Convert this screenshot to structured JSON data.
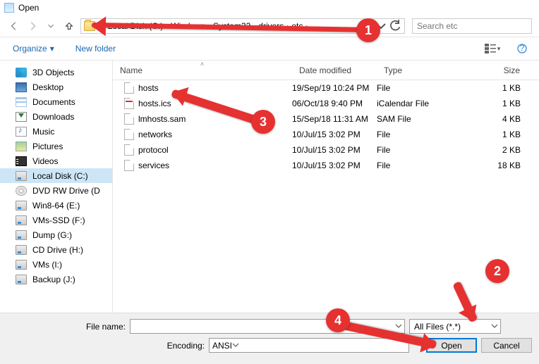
{
  "window": {
    "title": "Open"
  },
  "nav": {
    "breadcrumb": [
      "Local Disk (C:)",
      "Windows",
      "System32",
      "drivers",
      "etc"
    ],
    "search_placeholder": "Search etc"
  },
  "toolbar": {
    "organize": "Organize",
    "new_folder": "New folder"
  },
  "sidebar": {
    "items": [
      {
        "icon": "ic-3d",
        "label": "3D Objects"
      },
      {
        "icon": "ic-desktop",
        "label": "Desktop"
      },
      {
        "icon": "ic-doc",
        "label": "Documents"
      },
      {
        "icon": "ic-dl",
        "label": "Downloads"
      },
      {
        "icon": "ic-music",
        "label": "Music"
      },
      {
        "icon": "ic-pic",
        "label": "Pictures"
      },
      {
        "icon": "ic-vid",
        "label": "Videos"
      },
      {
        "icon": "ic-disk",
        "label": "Local Disk (C:)",
        "selected": true
      },
      {
        "icon": "ic-dvd",
        "label": "DVD RW Drive (D"
      },
      {
        "icon": "ic-disk",
        "label": "Win8-64 (E:)"
      },
      {
        "icon": "ic-disk",
        "label": "VMs-SSD (F:)"
      },
      {
        "icon": "ic-disk",
        "label": "Dump (G:)"
      },
      {
        "icon": "ic-disk",
        "label": "CD Drive (H:)"
      },
      {
        "icon": "ic-disk",
        "label": "VMs (I:)"
      },
      {
        "icon": "ic-disk",
        "label": "Backup (J:)"
      }
    ]
  },
  "columns": {
    "name": "Name",
    "date": "Date modified",
    "type": "Type",
    "size": "Size"
  },
  "files": [
    {
      "name": "hosts",
      "icon": "",
      "date": "19/Sep/19 10:24 PM",
      "type": "File",
      "size": "1 KB"
    },
    {
      "name": "hosts.ics",
      "icon": "cal",
      "date": "06/Oct/18 9:40 PM",
      "type": "iCalendar File",
      "size": "1 KB"
    },
    {
      "name": "lmhosts.sam",
      "icon": "",
      "date": "15/Sep/18 11:31 AM",
      "type": "SAM File",
      "size": "4 KB"
    },
    {
      "name": "networks",
      "icon": "",
      "date": "10/Jul/15 3:02 PM",
      "type": "File",
      "size": "1 KB"
    },
    {
      "name": "protocol",
      "icon": "",
      "date": "10/Jul/15 3:02 PM",
      "type": "File",
      "size": "2 KB"
    },
    {
      "name": "services",
      "icon": "",
      "date": "10/Jul/15 3:02 PM",
      "type": "File",
      "size": "18 KB"
    }
  ],
  "footer": {
    "filename_label": "File name:",
    "filename_value": "",
    "filter_label": "All Files  (*.*)",
    "encoding_label": "Encoding:",
    "encoding_value": "ANSI",
    "open_btn": "Open",
    "cancel_btn": "Cancel"
  },
  "annotations": {
    "c1": "1",
    "c2": "2",
    "c3": "3",
    "c4": "4"
  }
}
